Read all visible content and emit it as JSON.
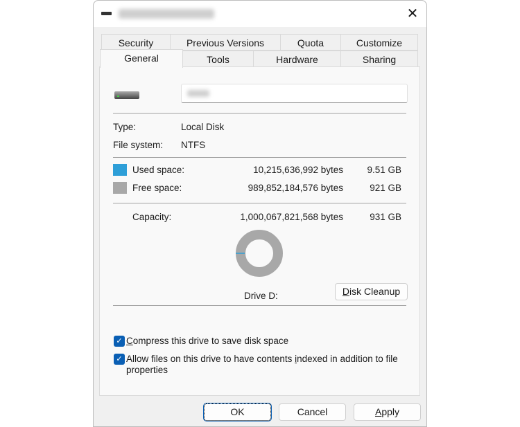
{
  "window": {
    "close_icon": "close-icon"
  },
  "tabs_row1": [
    "Security",
    "Previous Versions",
    "Quota",
    "Customize"
  ],
  "tabs_row2": [
    "General",
    "Tools",
    "Hardware",
    "Sharing"
  ],
  "info": {
    "type_label": "Type:",
    "type_value": "Local Disk",
    "fs_label": "File system:",
    "fs_value": "NTFS"
  },
  "space": {
    "used_label": "Used space:",
    "used_bytes": "10,215,636,992 bytes",
    "used_gb": "9.51 GB",
    "used_color": "#2e9fd8",
    "free_label": "Free space:",
    "free_bytes": "989,852,184,576 bytes",
    "free_gb": "921 GB",
    "free_color": "#a8a8a8",
    "cap_label": "Capacity:",
    "cap_bytes": "1,000,067,821,568 bytes",
    "cap_gb": "931 GB",
    "used_fraction": 0.0102
  },
  "drive_label": "Drive D:",
  "disk_cleanup": {
    "first": "D",
    "rest": "isk Cleanup"
  },
  "compress": {
    "first": "C",
    "rest": "ompress this drive to save disk space",
    "checked": true
  },
  "index": {
    "pre": "Allow files on this drive to have contents ",
    "u": "i",
    "post": "ndexed in addition to file properties",
    "checked": true
  },
  "buttons": {
    "ok": "OK",
    "cancel": "Cancel",
    "apply_u": "A",
    "apply_rest": "pply"
  }
}
